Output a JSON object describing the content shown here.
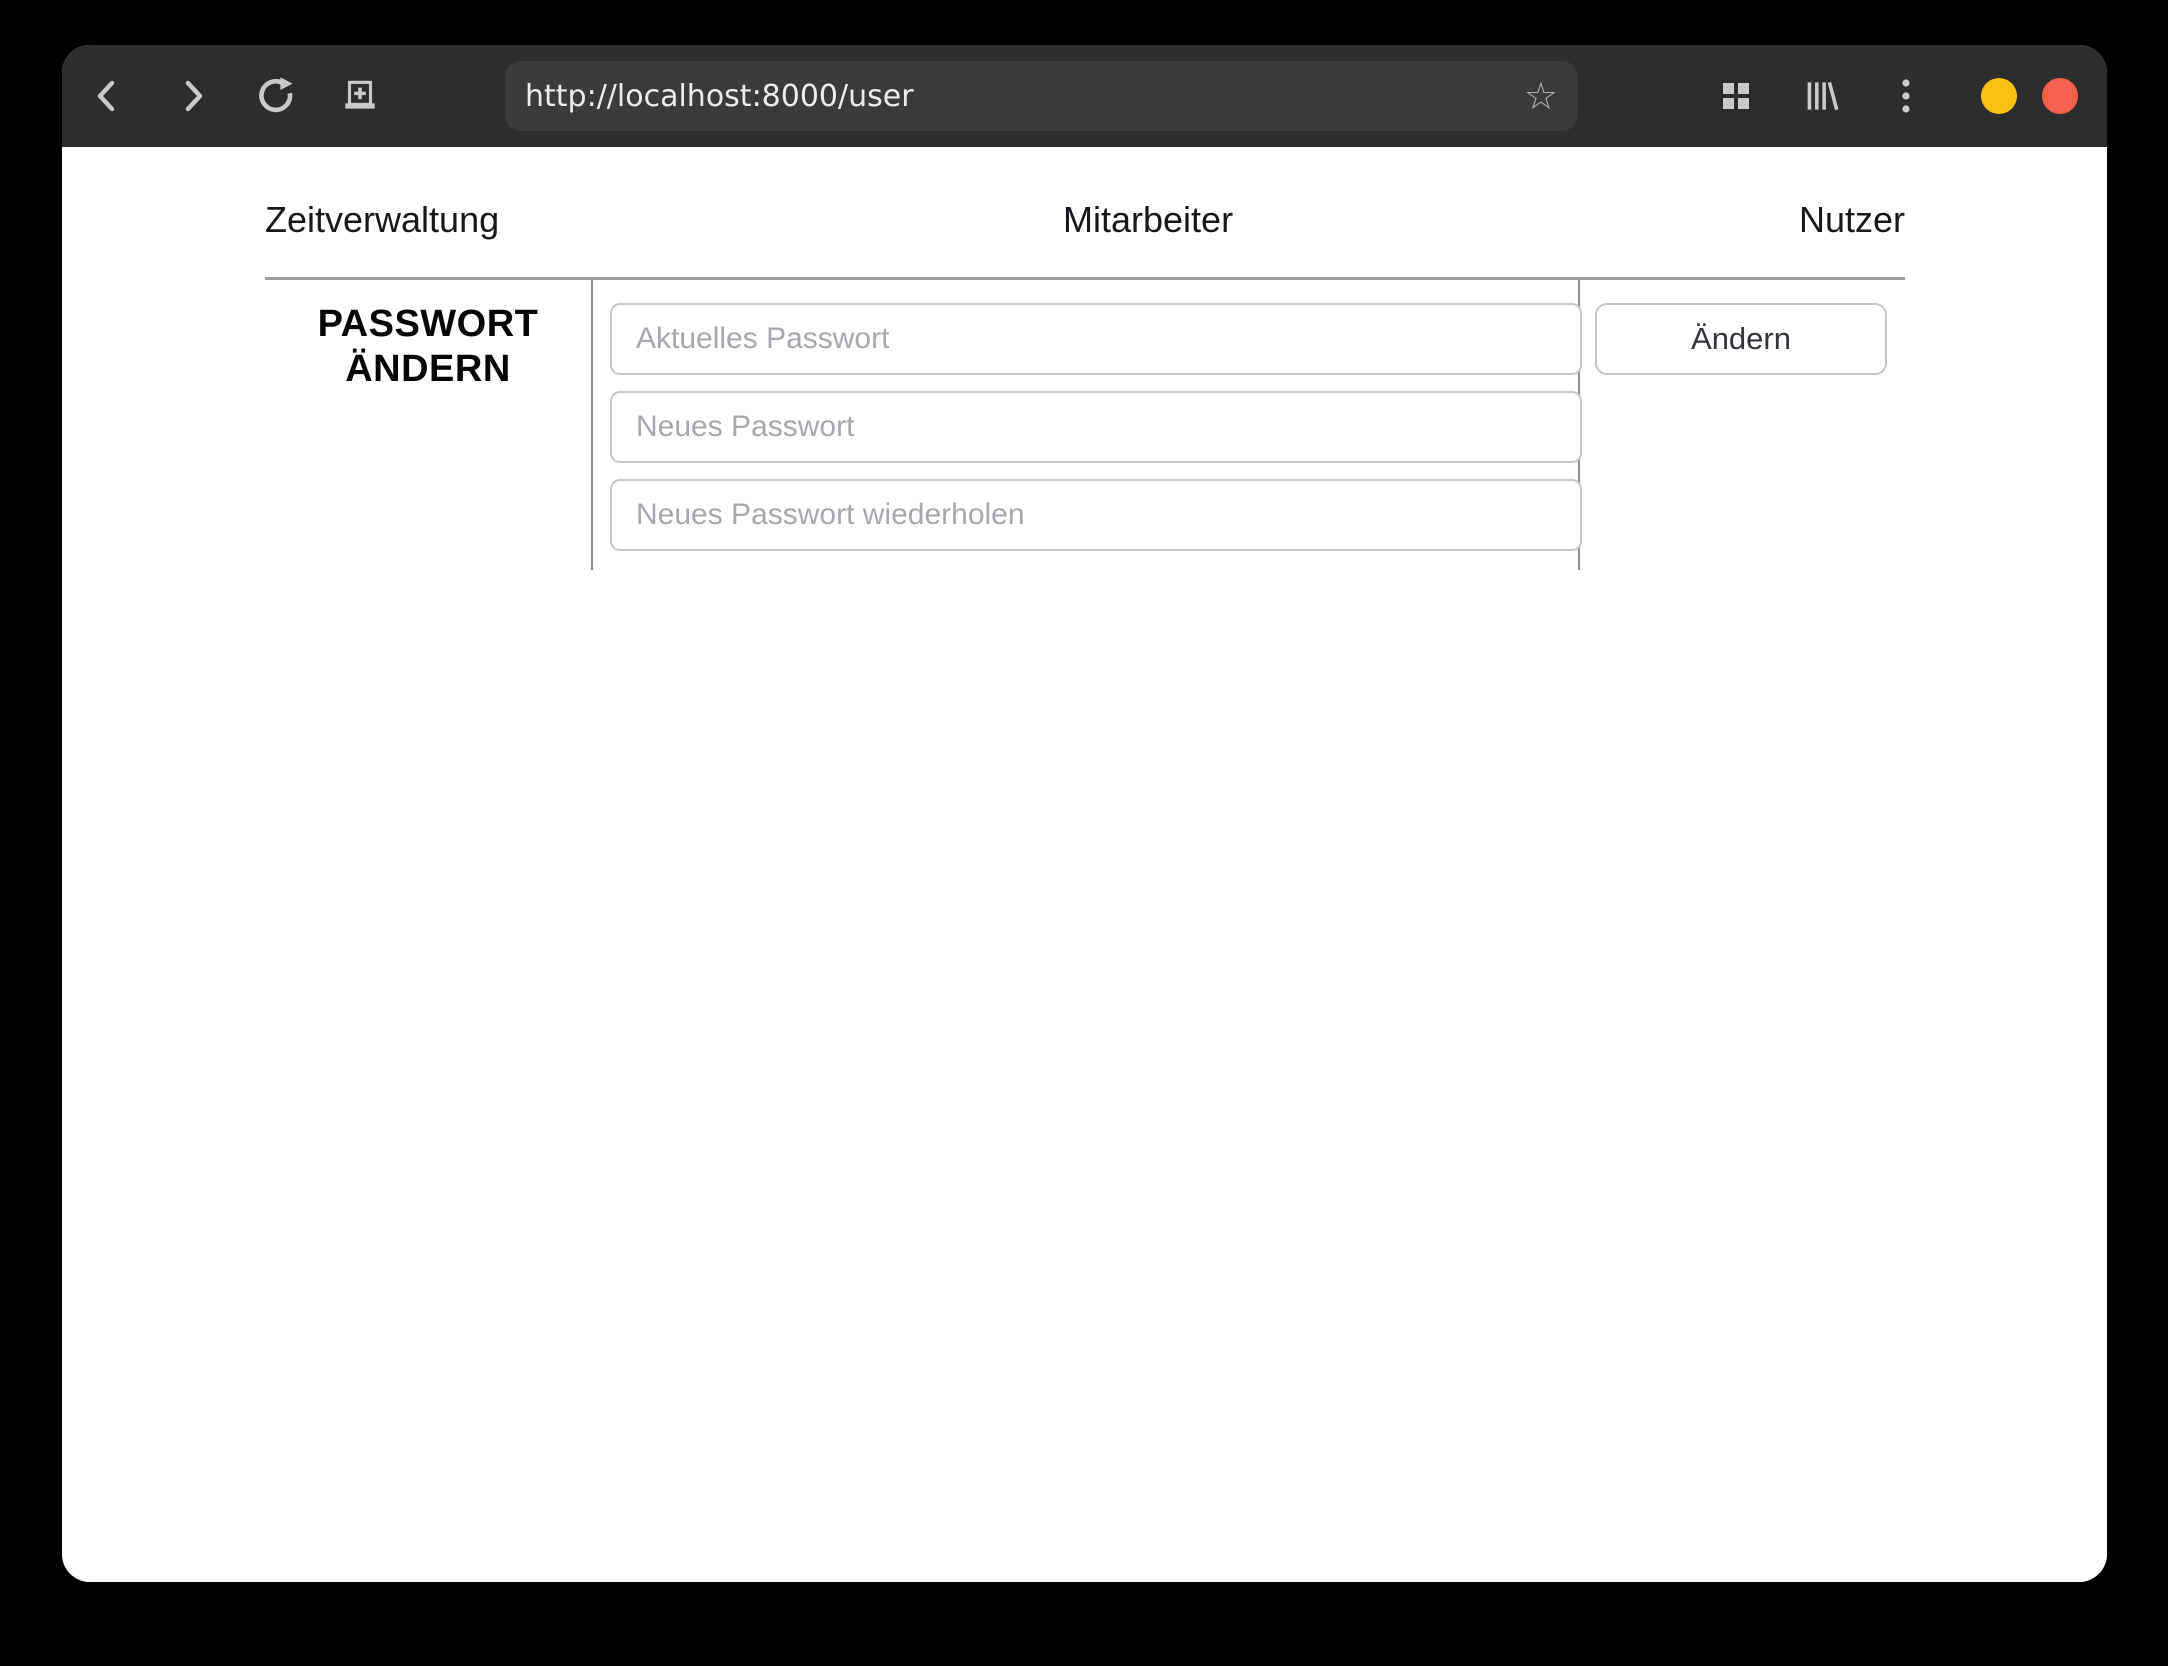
{
  "browser": {
    "url": "http://localhost:8000/user",
    "star_glyph": "☆",
    "toolbar_color": "#2d2d2d",
    "urlbar_color": "#3b3b3b",
    "window_controls": {
      "minimize_color": "#f9c211",
      "close_color": "#f6604f"
    }
  },
  "nav": {
    "items": [
      {
        "label": "Zeitverwaltung"
      },
      {
        "label": "Mitarbeiter"
      },
      {
        "label": "Nutzer"
      }
    ]
  },
  "password_form": {
    "heading": "PASSWORT ÄNDERN",
    "fields": [
      {
        "placeholder": "Aktuelles Passwort"
      },
      {
        "placeholder": "Neues Passwort"
      },
      {
        "placeholder": "Neues Passwort wiederholen"
      }
    ],
    "submit_label": "Ändern"
  }
}
